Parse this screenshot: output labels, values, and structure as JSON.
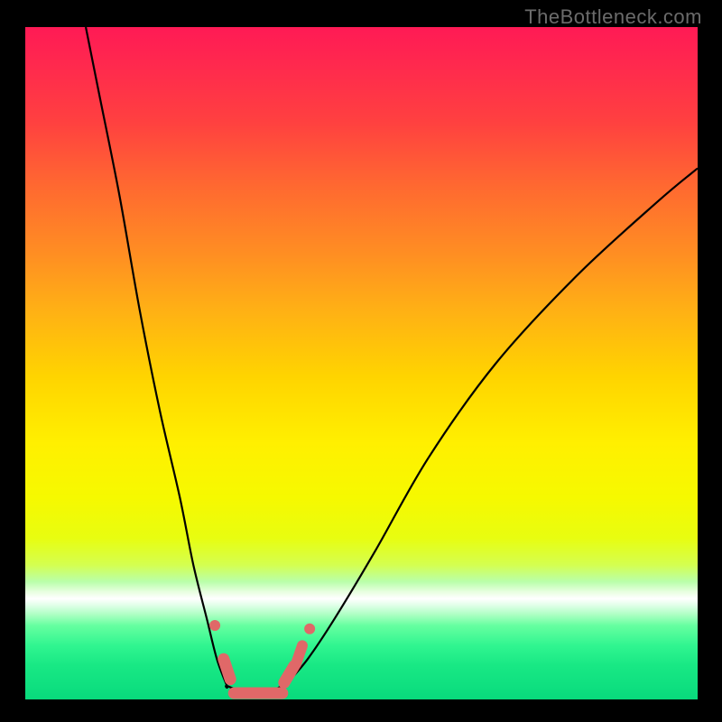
{
  "watermark": "TheBottleneck.com",
  "colors": {
    "page_bg": "#000000",
    "curve_stroke": "#000000",
    "marker_fill": "#e06868",
    "marker_stroke": "#8a3c3c"
  },
  "chart_data": {
    "type": "line",
    "title": "",
    "xlabel": "",
    "ylabel": "",
    "xlim": [
      0,
      100
    ],
    "ylim": [
      0,
      100
    ],
    "note": "Axis ticks and numeric labels are not rendered in the image; values below are normalized (0–100) estimates read from pixel positions. The vertical axis appears to represent a mismatch / bottleneck percentage (low = good / green, high = bad / red). The curve has a sharp minimum around x≈31.",
    "series": [
      {
        "name": "left-branch",
        "x": [
          9,
          11,
          14,
          17,
          20,
          23,
          25,
          27,
          28.5,
          30
        ],
        "y": [
          100,
          90,
          75,
          58,
          43,
          30,
          20,
          12,
          6,
          2
        ]
      },
      {
        "name": "valley-floor",
        "x": [
          30,
          33,
          36,
          39
        ],
        "y": [
          2,
          1,
          1,
          2.5
        ]
      },
      {
        "name": "right-branch",
        "x": [
          39,
          42,
          46,
          52,
          60,
          70,
          82,
          94,
          100
        ],
        "y": [
          2.5,
          6,
          12,
          22,
          36,
          50,
          63,
          74,
          79
        ]
      }
    ],
    "markers": {
      "name": "highlighted-points",
      "shape": "rounded-pill",
      "x": [
        28.2,
        29.5,
        30.5,
        33,
        36,
        38.5,
        40,
        41.2,
        42.3
      ],
      "y": [
        11,
        6,
        3,
        1.2,
        1.2,
        2.5,
        5,
        8,
        10.5
      ]
    }
  }
}
